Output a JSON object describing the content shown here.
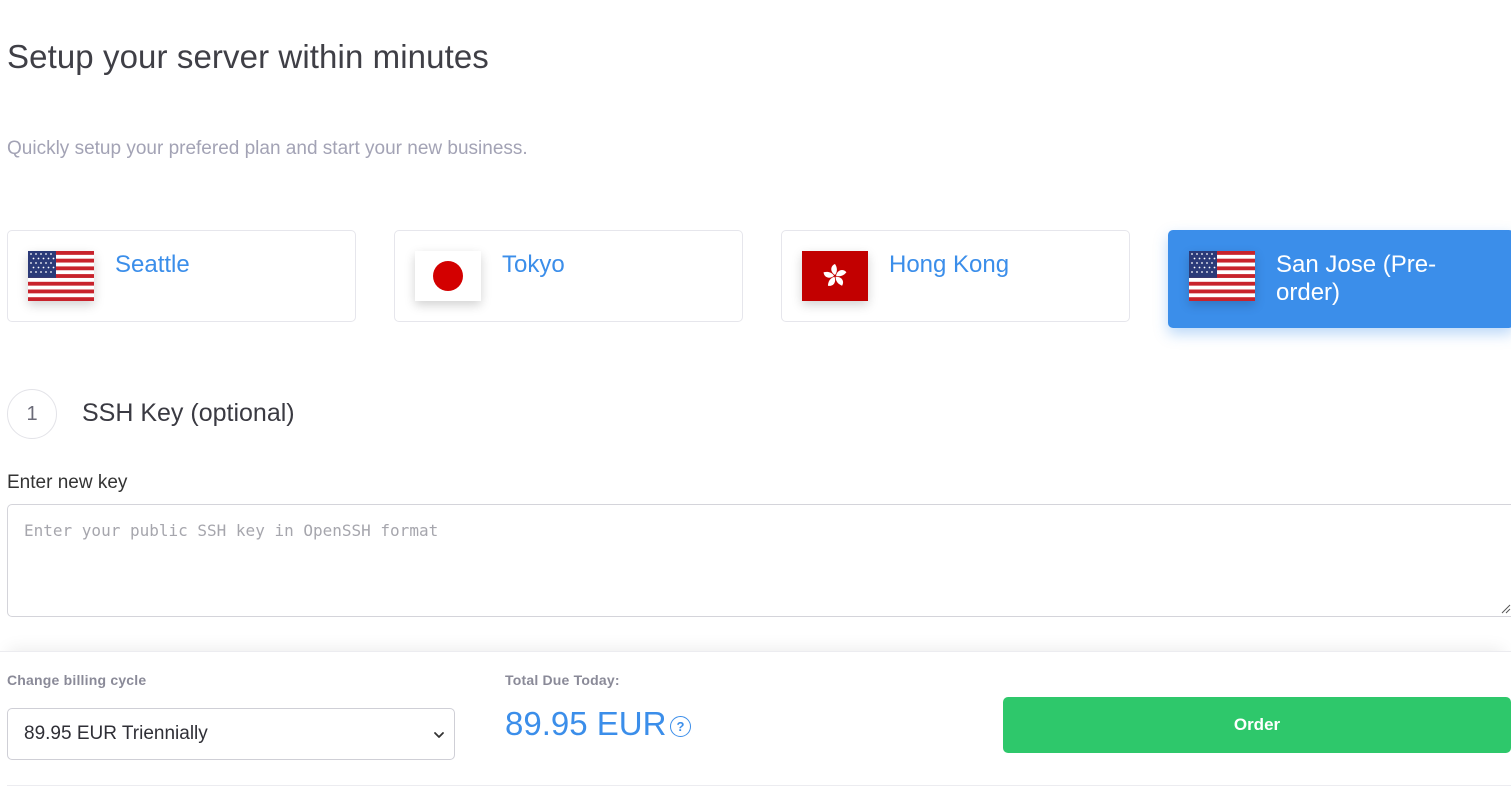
{
  "header": {
    "title": "Setup your server within minutes",
    "subtitle": "Quickly setup your prefered plan and start your new business."
  },
  "locations": [
    {
      "name": "Seattle",
      "flag": "us-flag-icon",
      "selected": false
    },
    {
      "name": "Tokyo",
      "flag": "japan-flag-icon",
      "selected": false
    },
    {
      "name": "Hong Kong",
      "flag": "hong-kong-flag-icon",
      "selected": false
    },
    {
      "name": "San Jose (Pre-order)",
      "flag": "us-flag-icon",
      "selected": true
    }
  ],
  "step": {
    "number": "1",
    "title": "SSH Key (optional)",
    "field_label": "Enter new key",
    "placeholder": "Enter your public SSH key in OpenSSH format",
    "value": ""
  },
  "billing": {
    "cycle_label": "Change billing cycle",
    "selected_cycle": "89.95 EUR Triennially",
    "total_label": "Total Due Today:",
    "total_value": "89.95 EUR",
    "help_icon": "question-circle-icon",
    "order_label": "Order"
  },
  "colors": {
    "accent_blue": "#3b8eea",
    "order_green": "#2ec86b",
    "muted_text": "#a3a3b5"
  }
}
